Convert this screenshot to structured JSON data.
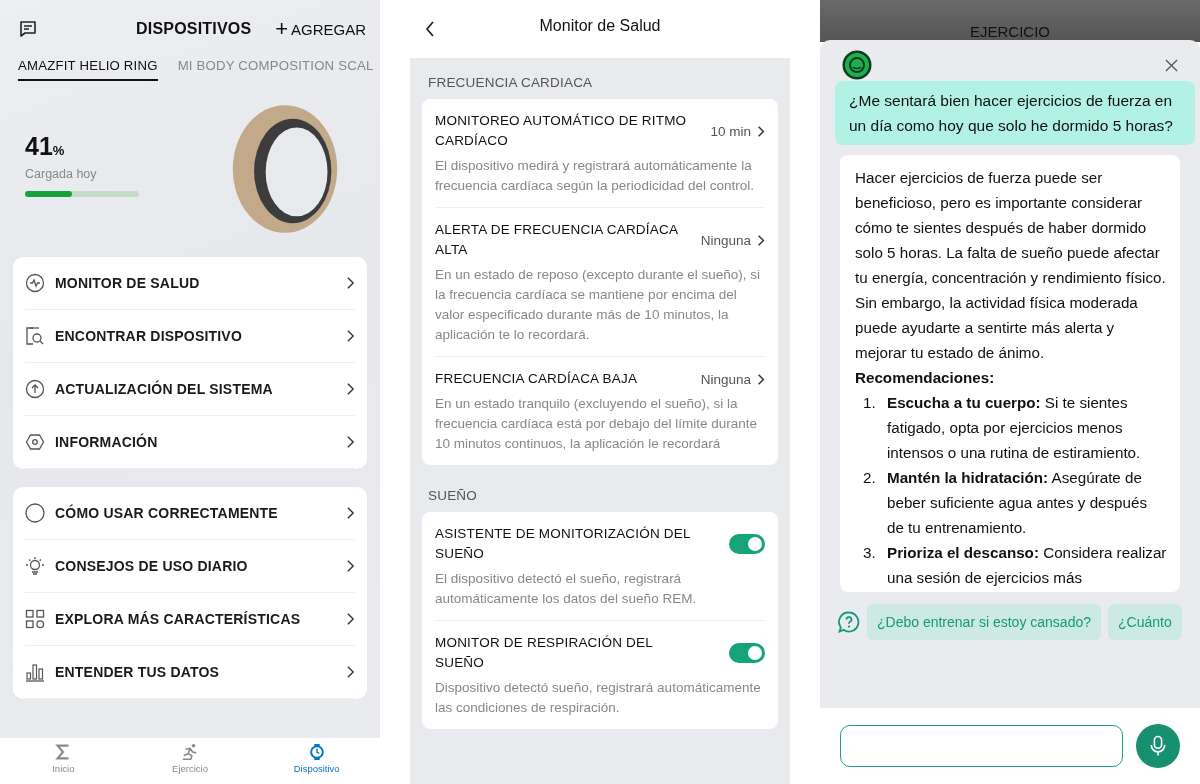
{
  "devices_screen": {
    "title": "DISPOSITIVOS",
    "add_button": {
      "icon": "+",
      "label": "AGREGAR"
    },
    "tabs": [
      {
        "label": "AMAZFIT HELIO RING",
        "selected": true
      },
      {
        "label": "MI BODY COMPOSITION SCAL",
        "selected": false
      }
    ],
    "battery": {
      "value": "41",
      "unit": "%",
      "caption": "Cargada hoy",
      "level": 0.41
    },
    "menu_groups": [
      [
        {
          "label": "MONITOR DE SALUD"
        },
        {
          "label": "ENCONTRAR DISPOSITIVO"
        },
        {
          "label": "ACTUALIZACIÓN DEL SISTEMA"
        },
        {
          "label": "INFORMACIÓN"
        }
      ],
      [
        {
          "label": "CÓMO USAR CORRECTAMENTE"
        },
        {
          "label": "CONSEJOS DE USO DIARIO"
        },
        {
          "label": "EXPLORA MÁS CARACTERÍSTICAS"
        },
        {
          "label": "ENTENDER TUS DATOS"
        }
      ]
    ],
    "nav": [
      {
        "label": "Inicio",
        "selected": false
      },
      {
        "label": "Ejercicio",
        "selected": false
      },
      {
        "label": "Dispositivo",
        "selected": true
      }
    ]
  },
  "health_screen": {
    "title": "Monitor de Salud",
    "sections": [
      {
        "heading": "FRECUENCIA CARDIACA",
        "items": [
          {
            "kind": "link",
            "title": "MONITOREO AUTOMÁTICO DE RITMO CARDÍACO",
            "value": "10 min",
            "description": "El dispositivo medirá y registrará automáticamente la frecuencia cardíaca según la periodicidad del control."
          },
          {
            "kind": "link",
            "title": "ALERTA DE FRECUENCIA CARDÍACA ALTA",
            "value": "Ninguna",
            "description": "En un estado de reposo (excepto durante el sueño), si la frecuencia cardíaca se mantiene por encima del valor especificado durante más de 10 minutos, la aplicación te lo recordará."
          },
          {
            "kind": "link",
            "title": "FRECUENCIA CARDÍACA BAJA",
            "value": "Ninguna",
            "description": "En un estado tranquilo (excluyendo el sueño), si la frecuencia cardíaca está por debajo del límite durante 10 minutos continuos, la aplicación le recordará"
          }
        ]
      },
      {
        "heading": "SUEÑO",
        "items": [
          {
            "kind": "toggle",
            "title": "ASISTENTE DE MONITORIZACIÓN DEL SUEÑO",
            "on": true,
            "description": "El dispositivo detectó el sueño, registrará automáticamente los datos del sueño REM."
          },
          {
            "kind": "toggle",
            "title": "MONITOR DE RESPIRACIÓN DEL SUEÑO",
            "on": true,
            "description": "Dispositivo detectó sueño, registrará automáticamente las condiciones de respiración."
          }
        ]
      }
    ]
  },
  "chat_screen": {
    "header_title": "EJERCICIO",
    "question": "¿Me sentará bien hacer ejercicios de fuerza en un día como hoy que solo he dormido 5 horas?",
    "answer": {
      "intro": "Hacer ejercicios de fuerza puede ser beneficioso, pero es importante considerar cómo te sientes después de haber dormido solo 5 horas. La falta de sueño puede afectar tu energía, concentración y rendimiento físico. Sin embargo, la actividad física moderada puede ayudarte a sentirte más alerta y mejorar tu estado de ánimo.",
      "heading": "Recomendaciones:",
      "list": [
        {
          "number": "1.",
          "text": "**Escucha a tu cuerpo:** Si te sientes fatigado, opta por ejercicios menos intensos o una rutina de estiramiento."
        },
        {
          "number": "2.",
          "text": "**Mantén la hidratación:** Asegúrate de beber suficiente agua antes y después de tu entrenamiento."
        },
        {
          "number": "3.",
          "text": "**Prioriza el descanso:** Considera realizar una sesión de ejercicios más"
        }
      ]
    },
    "suggestions": [
      "¿Debo entrenar si estoy cansado?",
      "¿Cuánto"
    ]
  }
}
